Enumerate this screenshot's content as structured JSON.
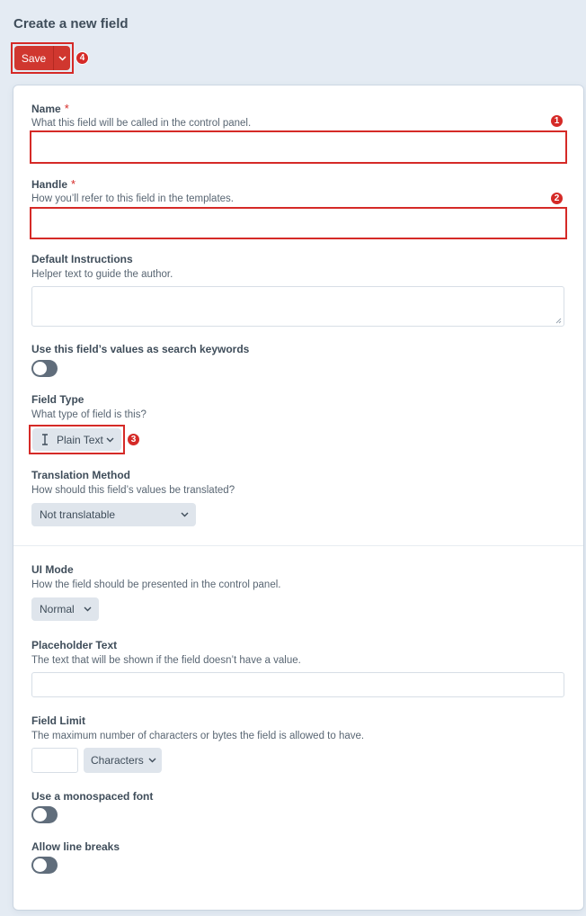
{
  "page": {
    "title": "Create a new field"
  },
  "toolbar": {
    "save_label": "Save"
  },
  "badges": {
    "name": "1",
    "handle": "2",
    "field_type": "3",
    "save": "4"
  },
  "fields": {
    "name": {
      "label": "Name",
      "required": "*",
      "hint": "What this field will be called in the control panel.",
      "value": ""
    },
    "handle": {
      "label": "Handle",
      "required": "*",
      "hint": "How you’ll refer to this field in the templates.",
      "value": ""
    },
    "instructions": {
      "label": "Default Instructions",
      "hint": "Helper text to guide the author.",
      "value": ""
    },
    "search_keywords": {
      "label": "Use this field’s values as search keywords",
      "checked": false
    },
    "field_type": {
      "label": "Field Type",
      "hint": "What type of field is this?",
      "value": "Plain Text",
      "icon": "text-cursor-icon"
    },
    "translation": {
      "label": "Translation Method",
      "hint": "How should this field’s values be translated?",
      "value": "Not translatable"
    },
    "ui_mode": {
      "label": "UI Mode",
      "hint": "How the field should be presented in the control panel.",
      "value": "Normal"
    },
    "placeholder": {
      "label": "Placeholder Text",
      "hint": "The text that will be shown if the field doesn’t have a value.",
      "value": ""
    },
    "field_limit": {
      "label": "Field Limit",
      "hint": "The maximum number of characters or bytes the field is allowed to have.",
      "value": "",
      "unit": "Characters"
    },
    "monospace": {
      "label": "Use a monospaced font",
      "checked": false
    },
    "line_breaks": {
      "label": "Allow line breaks",
      "checked": false
    }
  },
  "colors": {
    "accent": "#d0372f",
    "highlight": "#d52a27",
    "background": "#e4ebf3",
    "toggle_off": "#606d7b"
  }
}
